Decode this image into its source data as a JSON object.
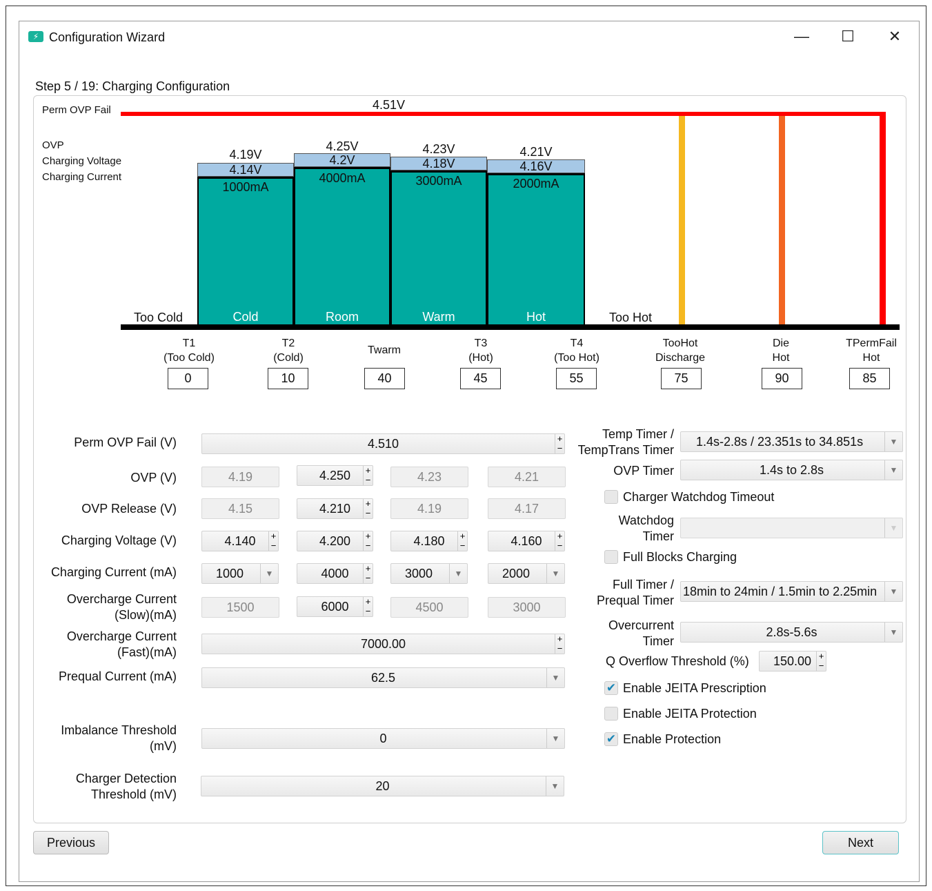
{
  "window": {
    "title": "Configuration Wizard",
    "min": "—",
    "max": "☐",
    "close": "✕"
  },
  "step": "Step 5 / 19: Charging Configuration",
  "chart": {
    "perm_ovp_label": "Perm OVP Fail",
    "perm_ovp_value": "4.51V",
    "legend": [
      "OVP",
      "Charging Voltage",
      "Charging Current"
    ],
    "too_cold": "Too Cold",
    "too_hot": "Too Hot",
    "bars": [
      {
        "ovp": "4.19V",
        "voltage": "4.14V",
        "current": "1000mA",
        "zone": "Cold"
      },
      {
        "ovp": "4.25V",
        "voltage": "4.2V",
        "current": "4000mA",
        "zone": "Room"
      },
      {
        "ovp": "4.23V",
        "voltage": "4.18V",
        "current": "3000mA",
        "zone": "Warm"
      },
      {
        "ovp": "4.21V",
        "voltage": "4.16V",
        "current": "2000mA",
        "zone": "Hot"
      }
    ],
    "line_colors": {
      "perm": "#ff0000",
      "toohot": "#f5b820",
      "die": "#f26522",
      "tpermfail": "#ff0000"
    }
  },
  "thresholds": [
    {
      "l1": "T1",
      "l2": "(Too Cold)",
      "value": "0"
    },
    {
      "l1": "T2",
      "l2": "(Cold)",
      "value": "10"
    },
    {
      "l1": "Twarm",
      "l2": "",
      "value": "40"
    },
    {
      "l1": "T3",
      "l2": "(Hot)",
      "value": "45"
    },
    {
      "l1": "T4",
      "l2": "(Too Hot)",
      "value": "55"
    },
    {
      "l1": "TooHot",
      "l2": "Discharge",
      "value": "75"
    },
    {
      "l1": "Die",
      "l2": "Hot",
      "value": "90"
    },
    {
      "l1": "TPermFail",
      "l2": "Hot",
      "value": "85"
    }
  ],
  "form": {
    "perm_ovp": {
      "label": "Perm OVP Fail (V)",
      "value": "4.510"
    },
    "ovp": {
      "label": "OVP (V)",
      "values": [
        "4.19",
        "4.250",
        "4.23",
        "4.21"
      ]
    },
    "ovp_release": {
      "label": "OVP Release (V)",
      "values": [
        "4.15",
        "4.210",
        "4.19",
        "4.17"
      ]
    },
    "charging_voltage": {
      "label": "Charging Voltage (V)",
      "values": [
        "4.140",
        "4.200",
        "4.180",
        "4.160"
      ]
    },
    "charging_current": {
      "label": "Charging Current (mA)",
      "values": [
        "1000",
        "4000",
        "3000",
        "2000"
      ]
    },
    "overcharge_slow": {
      "label1": "Overcharge Current",
      "label2": "(Slow)(mA)",
      "values": [
        "1500",
        "6000",
        "4500",
        "3000"
      ]
    },
    "overcharge_fast": {
      "label1": "Overcharge Current",
      "label2": "(Fast)(mA)",
      "value": "7000.00"
    },
    "prequal_current": {
      "label": "Prequal Current (mA)",
      "value": "62.5"
    },
    "imbalance": {
      "label1": "Imbalance Threshold",
      "label2": "(mV)",
      "value": "0"
    },
    "charger_detect": {
      "label1": "Charger Detection",
      "label2": "Threshold (mV)",
      "value": "20"
    }
  },
  "right": {
    "temp_timer": {
      "label1": "Temp Timer /",
      "label2": "TempTrans Timer",
      "value": "1.4s-2.8s / 23.351s to 34.851s"
    },
    "ovp_timer": {
      "label": "OVP Timer",
      "value": "1.4s to 2.8s"
    },
    "watchdog_cb": {
      "label": "Charger Watchdog Timeout",
      "checked": false
    },
    "watchdog_timer": {
      "label1": "Watchdog",
      "label2": "Timer",
      "value": ""
    },
    "full_blocks_cb": {
      "label": "Full Blocks Charging",
      "checked": false
    },
    "full_timer": {
      "label1": "Full Timer /",
      "label2": "Prequal Timer",
      "value": "18min to 24min / 1.5min to 2.25min"
    },
    "overcurrent_timer": {
      "label1": "Overcurrent",
      "label2": "Timer",
      "value": "2.8s-5.6s"
    },
    "q_overflow": {
      "label": "Q Overflow Threshold (%)",
      "value": "150.00"
    },
    "jeita_prescription": {
      "label": "Enable JEITA Prescription",
      "checked": true
    },
    "jeita_protection": {
      "label": "Enable JEITA Protection",
      "checked": false
    },
    "protection": {
      "label": "Enable Protection",
      "checked": true
    }
  },
  "buttons": {
    "previous": "Previous",
    "next": "Next"
  }
}
